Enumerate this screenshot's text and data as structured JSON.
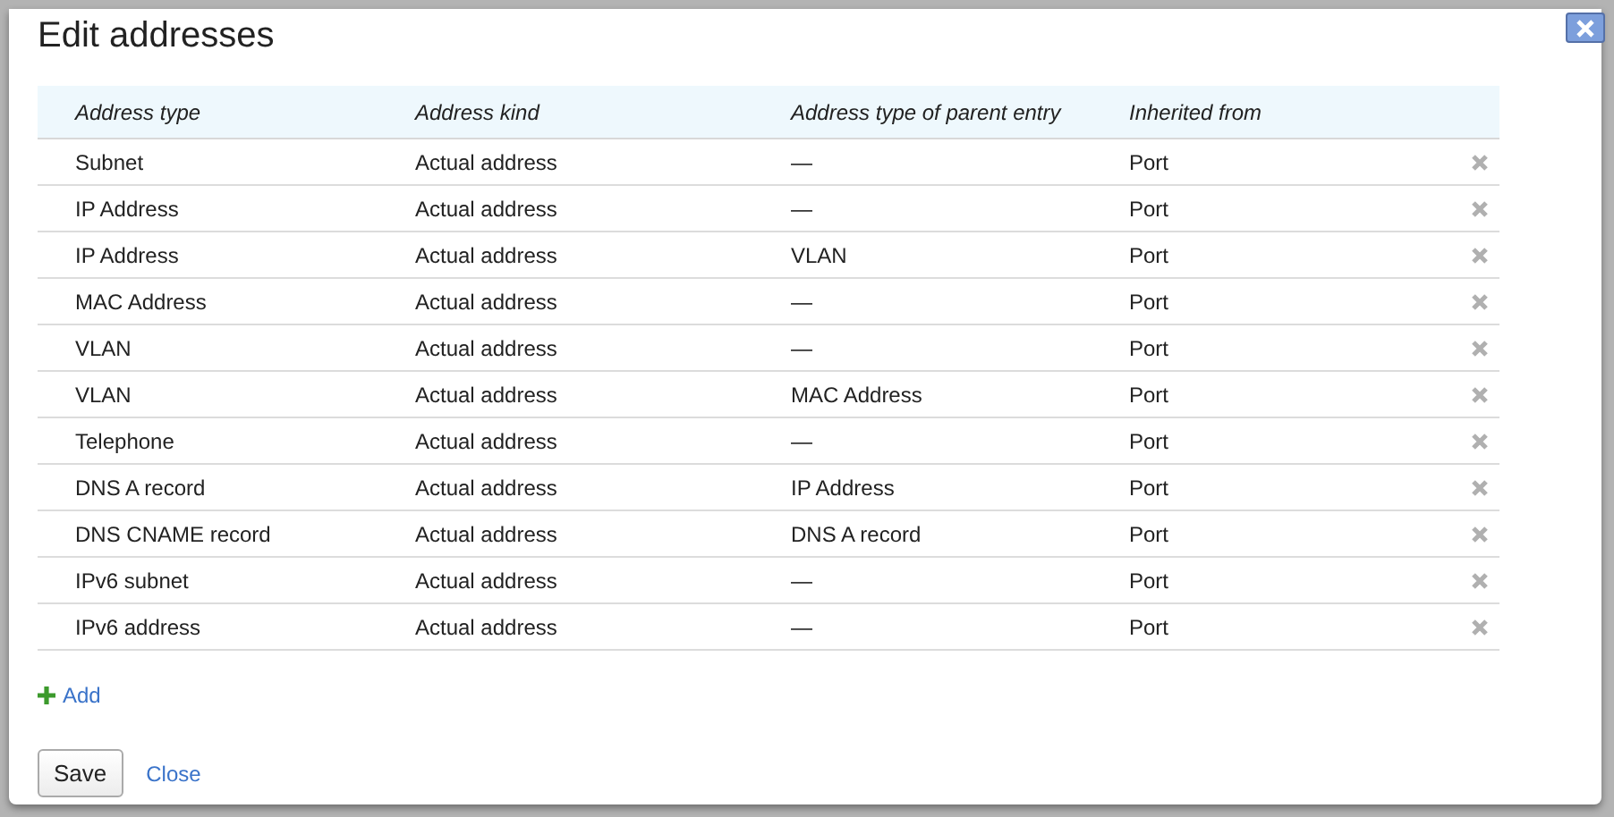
{
  "dialog": {
    "title": "Edit addresses"
  },
  "table": {
    "columns": [
      "Address type",
      "Address kind",
      "Address type of parent entry",
      "Inherited from"
    ],
    "rows": [
      {
        "address_type": "Subnet",
        "address_kind": "Actual address",
        "parent_type": "—",
        "inherited_from": "Port"
      },
      {
        "address_type": "IP Address",
        "address_kind": "Actual address",
        "parent_type": "—",
        "inherited_from": "Port"
      },
      {
        "address_type": "IP Address",
        "address_kind": "Actual address",
        "parent_type": "VLAN",
        "inherited_from": "Port"
      },
      {
        "address_type": "MAC Address",
        "address_kind": "Actual address",
        "parent_type": "—",
        "inherited_from": "Port"
      },
      {
        "address_type": "VLAN",
        "address_kind": "Actual address",
        "parent_type": "—",
        "inherited_from": "Port"
      },
      {
        "address_type": "VLAN",
        "address_kind": "Actual address",
        "parent_type": "MAC Address",
        "inherited_from": "Port"
      },
      {
        "address_type": "Telephone",
        "address_kind": "Actual address",
        "parent_type": "—",
        "inherited_from": "Port"
      },
      {
        "address_type": "DNS A record",
        "address_kind": "Actual address",
        "parent_type": "IP Address",
        "inherited_from": "Port"
      },
      {
        "address_type": "DNS CNAME record",
        "address_kind": "Actual address",
        "parent_type": "DNS A record",
        "inherited_from": "Port"
      },
      {
        "address_type": "IPv6 subnet",
        "address_kind": "Actual address",
        "parent_type": "—",
        "inherited_from": "Port"
      },
      {
        "address_type": "IPv6 address",
        "address_kind": "Actual address",
        "parent_type": "—",
        "inherited_from": "Port"
      }
    ]
  },
  "add_link": "Add",
  "buttons": {
    "save": "Save",
    "close": "Close"
  }
}
